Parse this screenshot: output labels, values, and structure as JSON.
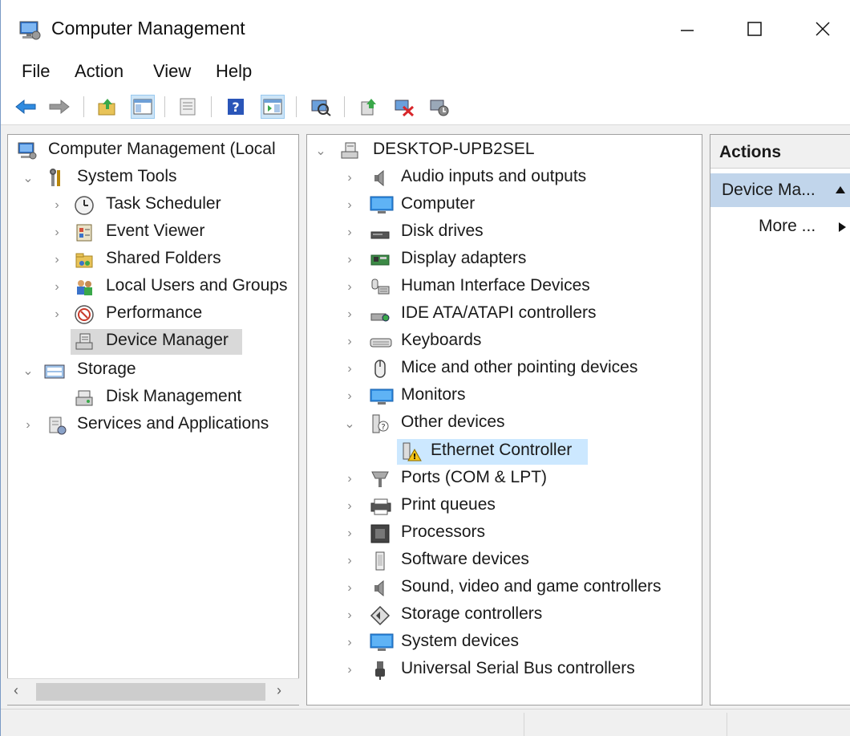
{
  "window": {
    "title": "Computer Management"
  },
  "menu": {
    "items": [
      {
        "label": "File"
      },
      {
        "label": "Action"
      },
      {
        "label": "View"
      },
      {
        "label": "Help"
      }
    ]
  },
  "toolbar": {
    "icons": [
      "back-icon",
      "forward-icon",
      "up-folder-icon",
      "show-hide-console-tree-icon",
      "properties-icon",
      "help-icon",
      "show-hide-action-pane-icon",
      "scan-hardware-icon",
      "update-driver-icon",
      "disable-device-icon",
      "enable-device-icon"
    ]
  },
  "left_tree": {
    "root": "Computer Management (Local",
    "items": [
      {
        "label": "System Tools",
        "expanded": true
      },
      {
        "label": "Task Scheduler"
      },
      {
        "label": "Event Viewer"
      },
      {
        "label": "Shared Folders"
      },
      {
        "label": "Local Users and Groups"
      },
      {
        "label": "Performance"
      },
      {
        "label": "Device Manager",
        "selected": true
      },
      {
        "label": "Storage",
        "expanded": true
      },
      {
        "label": "Disk Management"
      },
      {
        "label": "Services and Applications"
      }
    ]
  },
  "device_tree": {
    "root": "DESKTOP-UPB2SEL",
    "items": [
      {
        "label": "Audio inputs and outputs"
      },
      {
        "label": "Computer"
      },
      {
        "label": "Disk drives"
      },
      {
        "label": "Display adapters"
      },
      {
        "label": "Human Interface Devices"
      },
      {
        "label": "IDE ATA/ATAPI controllers"
      },
      {
        "label": "Keyboards"
      },
      {
        "label": "Mice and other pointing devices"
      },
      {
        "label": "Monitors"
      },
      {
        "label": "Other devices",
        "expanded": true
      },
      {
        "label": "Ethernet Controller",
        "child": true,
        "warning": true
      },
      {
        "label": "Ports (COM & LPT)"
      },
      {
        "label": "Print queues"
      },
      {
        "label": "Processors"
      },
      {
        "label": "Software devices"
      },
      {
        "label": "Sound, video and game controllers"
      },
      {
        "label": "Storage controllers"
      },
      {
        "label": "System devices"
      },
      {
        "label": "Universal Serial Bus controllers"
      }
    ]
  },
  "actions": {
    "header": "Actions",
    "section": "Device Ma...",
    "more": "More ..."
  },
  "colors": {
    "selection_gray": "#d9d9d9",
    "selection_blue": "#cce8ff",
    "actions_section": "#c1d5eb",
    "accent_blue": "#2a7bd4"
  }
}
